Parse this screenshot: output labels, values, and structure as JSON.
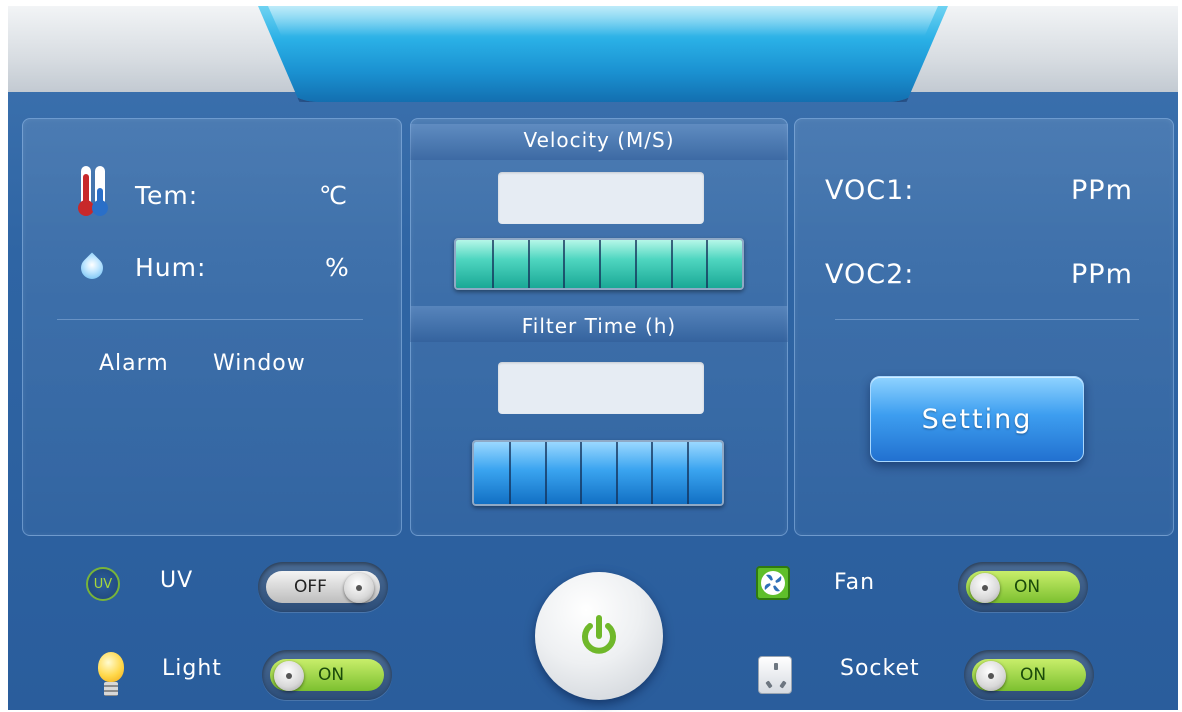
{
  "panel_left": {
    "temperature_label": "Tem:",
    "temperature_unit": "℃",
    "humidity_label": "Hum:",
    "humidity_unit": "%",
    "alarm_label": "Alarm",
    "window_label": "Window"
  },
  "panel_center": {
    "velocity_title": "Velocity (M/S)",
    "velocity_value": "",
    "velocity_bar_level": 1.0,
    "filter_title": "Filter Time (h)",
    "filter_value": "",
    "filter_bar_level": 1.0
  },
  "panel_right": {
    "voc1_label": "VOC1:",
    "voc1_unit": "PPm",
    "voc2_label": "VOC2:",
    "voc2_unit": "PPm",
    "setting_button": "Setting"
  },
  "controls": {
    "uv": {
      "icon_text": "UV",
      "label": "UV",
      "state": "OFF"
    },
    "light": {
      "label": "Light",
      "state": "ON"
    },
    "fan": {
      "label": "Fan",
      "state": "ON"
    },
    "socket": {
      "label": "Socket",
      "state": "ON"
    }
  },
  "icons": {
    "temperature": "thermometer-icon",
    "humidity": "water-drop-icon",
    "light": "light-bulb-icon",
    "fan": "fan-icon",
    "socket": "power-socket-icon",
    "power": "power-icon"
  },
  "colors": {
    "background": "#2f65a4",
    "header_tab": "#2ab0e6",
    "velocity_bar": "#4fd6c0",
    "filter_bar": "#3aa4f0",
    "toggle_on": "#a6dc46",
    "power_symbol": "#6fb82a"
  }
}
